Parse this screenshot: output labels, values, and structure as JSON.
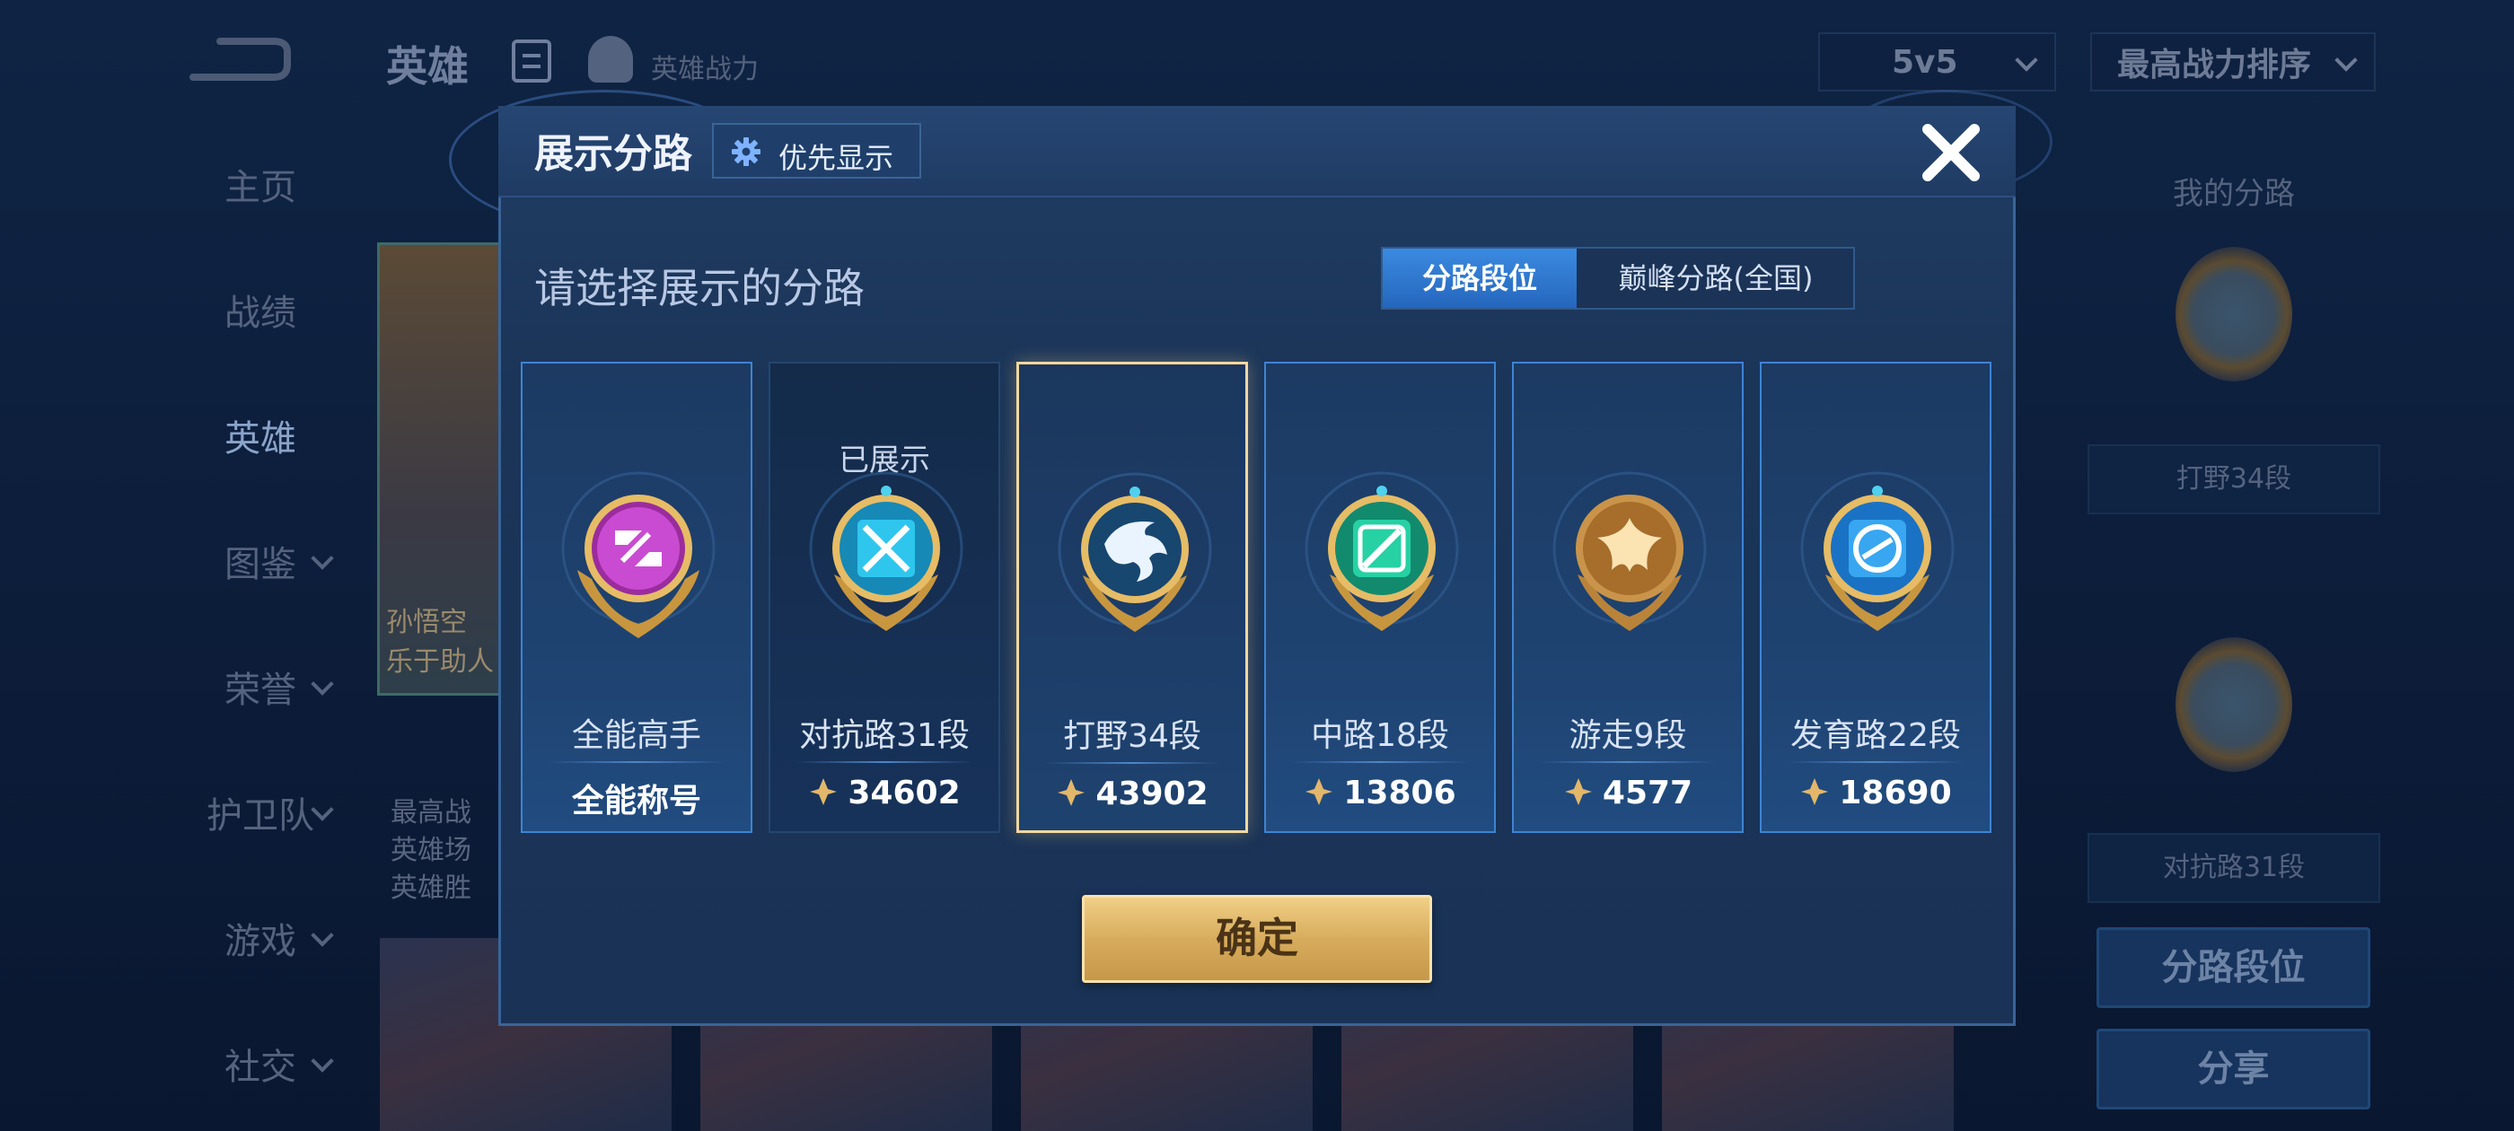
{
  "app": {
    "title": "英雄",
    "hero_power_label": "英雄战力",
    "mode_dropdown": "5v5",
    "sort_dropdown": "最高战力排序"
  },
  "sidebar": {
    "items": [
      {
        "label": "主页",
        "active": false,
        "expandable": false
      },
      {
        "label": "战绩",
        "active": false,
        "expandable": false
      },
      {
        "label": "英雄",
        "active": true,
        "expandable": false
      },
      {
        "label": "图鉴",
        "active": false,
        "expandable": true
      },
      {
        "label": "荣誉",
        "active": false,
        "expandable": true
      },
      {
        "label": "护卫队",
        "active": false,
        "expandable": true
      },
      {
        "label": "游戏",
        "active": false,
        "expandable": true
      },
      {
        "label": "社交",
        "active": false,
        "expandable": true
      }
    ]
  },
  "background": {
    "hero_card_lines": [
      "孙悟空",
      "乐于助人"
    ],
    "hero_stats_lines": [
      "最高战",
      "英雄场",
      "英雄胜"
    ]
  },
  "right_panel": {
    "title": "我的分路",
    "route_1": "打野34段",
    "route_2": "对抗路31段",
    "btn_route_rank": "分路段位",
    "btn_share": "分享"
  },
  "modal": {
    "title": "展示分路",
    "priority_label": "优先显示",
    "prompt": "请选择展示的分路",
    "tabs": [
      {
        "label": "分路段位",
        "active": true
      },
      {
        "label": "巅峰分路(全国)",
        "active": false
      }
    ],
    "cards": [
      {
        "status": "",
        "name": "全能高手",
        "value": "全能称号",
        "has_power_icon": false,
        "emblem": "purple",
        "state": "on"
      },
      {
        "status": "已展示",
        "name": "对抗路31段",
        "value": "34602",
        "has_power_icon": true,
        "emblem": "cyan-x",
        "state": "dim"
      },
      {
        "status": "",
        "name": "打野34段",
        "value": "43902",
        "has_power_icon": true,
        "emblem": "dragon",
        "state": "sel"
      },
      {
        "status": "",
        "name": "中路18段",
        "value": "13806",
        "has_power_icon": true,
        "emblem": "green",
        "state": "on"
      },
      {
        "status": "",
        "name": "游走9段",
        "value": "4577",
        "has_power_icon": true,
        "emblem": "gold",
        "state": "on"
      },
      {
        "status": "",
        "name": "发育路22段",
        "value": "18690",
        "has_power_icon": true,
        "emblem": "blue-s",
        "state": "on"
      }
    ],
    "confirm_label": "确定"
  },
  "colors": {
    "accent_blue": "#2f7de0",
    "gold": "#e2b76a",
    "modal_bg": "#1d375c",
    "page_bg": "#0a1a33"
  }
}
